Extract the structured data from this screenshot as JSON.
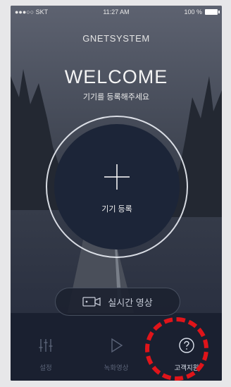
{
  "status_bar": {
    "carrier": "●●●○○ SKT",
    "time": "11:27 AM",
    "battery": "100 %"
  },
  "brand": "GNETSYSTEM",
  "welcome": {
    "title": "WELCOME",
    "subtitle": "기기를 등록해주세요"
  },
  "register_button": {
    "label": "기기 등록",
    "icon": "plus-icon"
  },
  "live_button": {
    "label": "실시간 영상",
    "icon": "live-video-icon"
  },
  "tabs": [
    {
      "label": "설정",
      "icon": "settings-sliders-icon",
      "active": false
    },
    {
      "label": "녹화영상",
      "icon": "play-icon",
      "active": false
    },
    {
      "label": "고객지원",
      "icon": "help-question-icon",
      "active": true
    }
  ],
  "colors": {
    "accent_ring": "#eceef5",
    "tab_active": "#dde3ee",
    "tab_inactive": "#5b6478",
    "highlight": "#e0141a"
  }
}
